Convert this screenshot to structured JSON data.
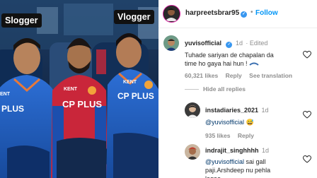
{
  "photo": {
    "caption_left": "Slogger",
    "caption_right": "Vlogger",
    "jersey_text": "CP PLUS",
    "jersey_text_small": "KENT"
  },
  "post": {
    "username": "harpreetsbrar95",
    "verified_mark": "✓",
    "separator": "•",
    "follow_label": "Follow"
  },
  "comments": [
    {
      "username": "yuvisofficial",
      "time": "1d",
      "edited": "· Edited",
      "text_line1": "Tuhade sariyan de chapalan da",
      "text_line2": "time ho gaya hai hun !",
      "likes": "60,321 likes",
      "reply_label": "Reply",
      "translation_label": "See translation",
      "hide_replies_label": "Hide all replies"
    }
  ],
  "replies": [
    {
      "username": "instadiaries_2021",
      "time": "1d",
      "mention": "@yuvisofficial",
      "emoji": "😅",
      "likes": "935 likes",
      "reply_label": "Reply"
    },
    {
      "username": "indrajit_singhhhh",
      "time": "1d",
      "mention": "@yuvisofficial",
      "text_rest": " sai gall",
      "text_line2": "paji.Arshdeep nu pehla",
      "text_line3": "lagao"
    }
  ],
  "icons": {
    "heart": "heart-outline-icon",
    "verified": "verified-badge-icon",
    "more": "more-icon"
  },
  "colors": {
    "accent": "#0095f6",
    "muted": "#8e8e8e",
    "mention": "#00376b",
    "verified": "#3897f0"
  }
}
